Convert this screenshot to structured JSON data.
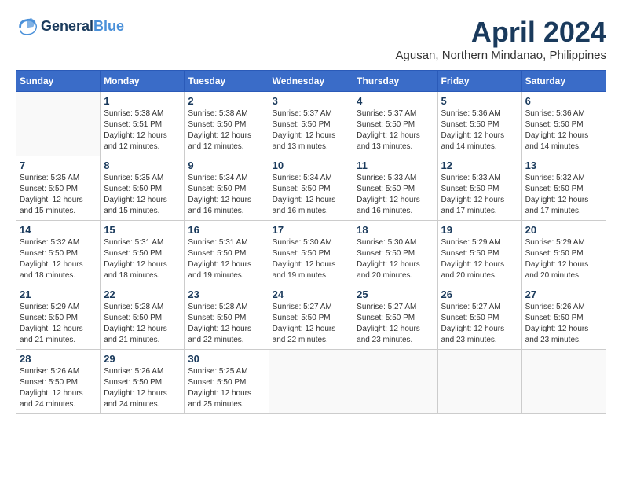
{
  "logo": {
    "line1": "General",
    "line2": "Blue"
  },
  "title": "April 2024",
  "subtitle": "Agusan, Northern Mindanao, Philippines",
  "days_of_week": [
    "Sunday",
    "Monday",
    "Tuesday",
    "Wednesday",
    "Thursday",
    "Friday",
    "Saturday"
  ],
  "weeks": [
    [
      {
        "day": "",
        "empty": true
      },
      {
        "day": "1",
        "sunrise": "5:38 AM",
        "sunset": "5:51 PM",
        "daylight": "12 hours and 12 minutes."
      },
      {
        "day": "2",
        "sunrise": "5:38 AM",
        "sunset": "5:50 PM",
        "daylight": "12 hours and 12 minutes."
      },
      {
        "day": "3",
        "sunrise": "5:37 AM",
        "sunset": "5:50 PM",
        "daylight": "12 hours and 13 minutes."
      },
      {
        "day": "4",
        "sunrise": "5:37 AM",
        "sunset": "5:50 PM",
        "daylight": "12 hours and 13 minutes."
      },
      {
        "day": "5",
        "sunrise": "5:36 AM",
        "sunset": "5:50 PM",
        "daylight": "12 hours and 14 minutes."
      },
      {
        "day": "6",
        "sunrise": "5:36 AM",
        "sunset": "5:50 PM",
        "daylight": "12 hours and 14 minutes."
      }
    ],
    [
      {
        "day": "7",
        "sunrise": "5:35 AM",
        "sunset": "5:50 PM",
        "daylight": "12 hours and 15 minutes."
      },
      {
        "day": "8",
        "sunrise": "5:35 AM",
        "sunset": "5:50 PM",
        "daylight": "12 hours and 15 minutes."
      },
      {
        "day": "9",
        "sunrise": "5:34 AM",
        "sunset": "5:50 PM",
        "daylight": "12 hours and 16 minutes."
      },
      {
        "day": "10",
        "sunrise": "5:34 AM",
        "sunset": "5:50 PM",
        "daylight": "12 hours and 16 minutes."
      },
      {
        "day": "11",
        "sunrise": "5:33 AM",
        "sunset": "5:50 PM",
        "daylight": "12 hours and 16 minutes."
      },
      {
        "day": "12",
        "sunrise": "5:33 AM",
        "sunset": "5:50 PM",
        "daylight": "12 hours and 17 minutes."
      },
      {
        "day": "13",
        "sunrise": "5:32 AM",
        "sunset": "5:50 PM",
        "daylight": "12 hours and 17 minutes."
      }
    ],
    [
      {
        "day": "14",
        "sunrise": "5:32 AM",
        "sunset": "5:50 PM",
        "daylight": "12 hours and 18 minutes."
      },
      {
        "day": "15",
        "sunrise": "5:31 AM",
        "sunset": "5:50 PM",
        "daylight": "12 hours and 18 minutes."
      },
      {
        "day": "16",
        "sunrise": "5:31 AM",
        "sunset": "5:50 PM",
        "daylight": "12 hours and 19 minutes."
      },
      {
        "day": "17",
        "sunrise": "5:30 AM",
        "sunset": "5:50 PM",
        "daylight": "12 hours and 19 minutes."
      },
      {
        "day": "18",
        "sunrise": "5:30 AM",
        "sunset": "5:50 PM",
        "daylight": "12 hours and 20 minutes."
      },
      {
        "day": "19",
        "sunrise": "5:29 AM",
        "sunset": "5:50 PM",
        "daylight": "12 hours and 20 minutes."
      },
      {
        "day": "20",
        "sunrise": "5:29 AM",
        "sunset": "5:50 PM",
        "daylight": "12 hours and 20 minutes."
      }
    ],
    [
      {
        "day": "21",
        "sunrise": "5:29 AM",
        "sunset": "5:50 PM",
        "daylight": "12 hours and 21 minutes."
      },
      {
        "day": "22",
        "sunrise": "5:28 AM",
        "sunset": "5:50 PM",
        "daylight": "12 hours and 21 minutes."
      },
      {
        "day": "23",
        "sunrise": "5:28 AM",
        "sunset": "5:50 PM",
        "daylight": "12 hours and 22 minutes."
      },
      {
        "day": "24",
        "sunrise": "5:27 AM",
        "sunset": "5:50 PM",
        "daylight": "12 hours and 22 minutes."
      },
      {
        "day": "25",
        "sunrise": "5:27 AM",
        "sunset": "5:50 PM",
        "daylight": "12 hours and 23 minutes."
      },
      {
        "day": "26",
        "sunrise": "5:27 AM",
        "sunset": "5:50 PM",
        "daylight": "12 hours and 23 minutes."
      },
      {
        "day": "27",
        "sunrise": "5:26 AM",
        "sunset": "5:50 PM",
        "daylight": "12 hours and 23 minutes."
      }
    ],
    [
      {
        "day": "28",
        "sunrise": "5:26 AM",
        "sunset": "5:50 PM",
        "daylight": "12 hours and 24 minutes."
      },
      {
        "day": "29",
        "sunrise": "5:26 AM",
        "sunset": "5:50 PM",
        "daylight": "12 hours and 24 minutes."
      },
      {
        "day": "30",
        "sunrise": "5:25 AM",
        "sunset": "5:50 PM",
        "daylight": "12 hours and 25 minutes."
      },
      {
        "day": "",
        "empty": true
      },
      {
        "day": "",
        "empty": true
      },
      {
        "day": "",
        "empty": true
      },
      {
        "day": "",
        "empty": true
      }
    ]
  ],
  "labels": {
    "sunrise_prefix": "Sunrise: ",
    "sunset_prefix": "Sunset: ",
    "daylight_prefix": "Daylight: "
  }
}
